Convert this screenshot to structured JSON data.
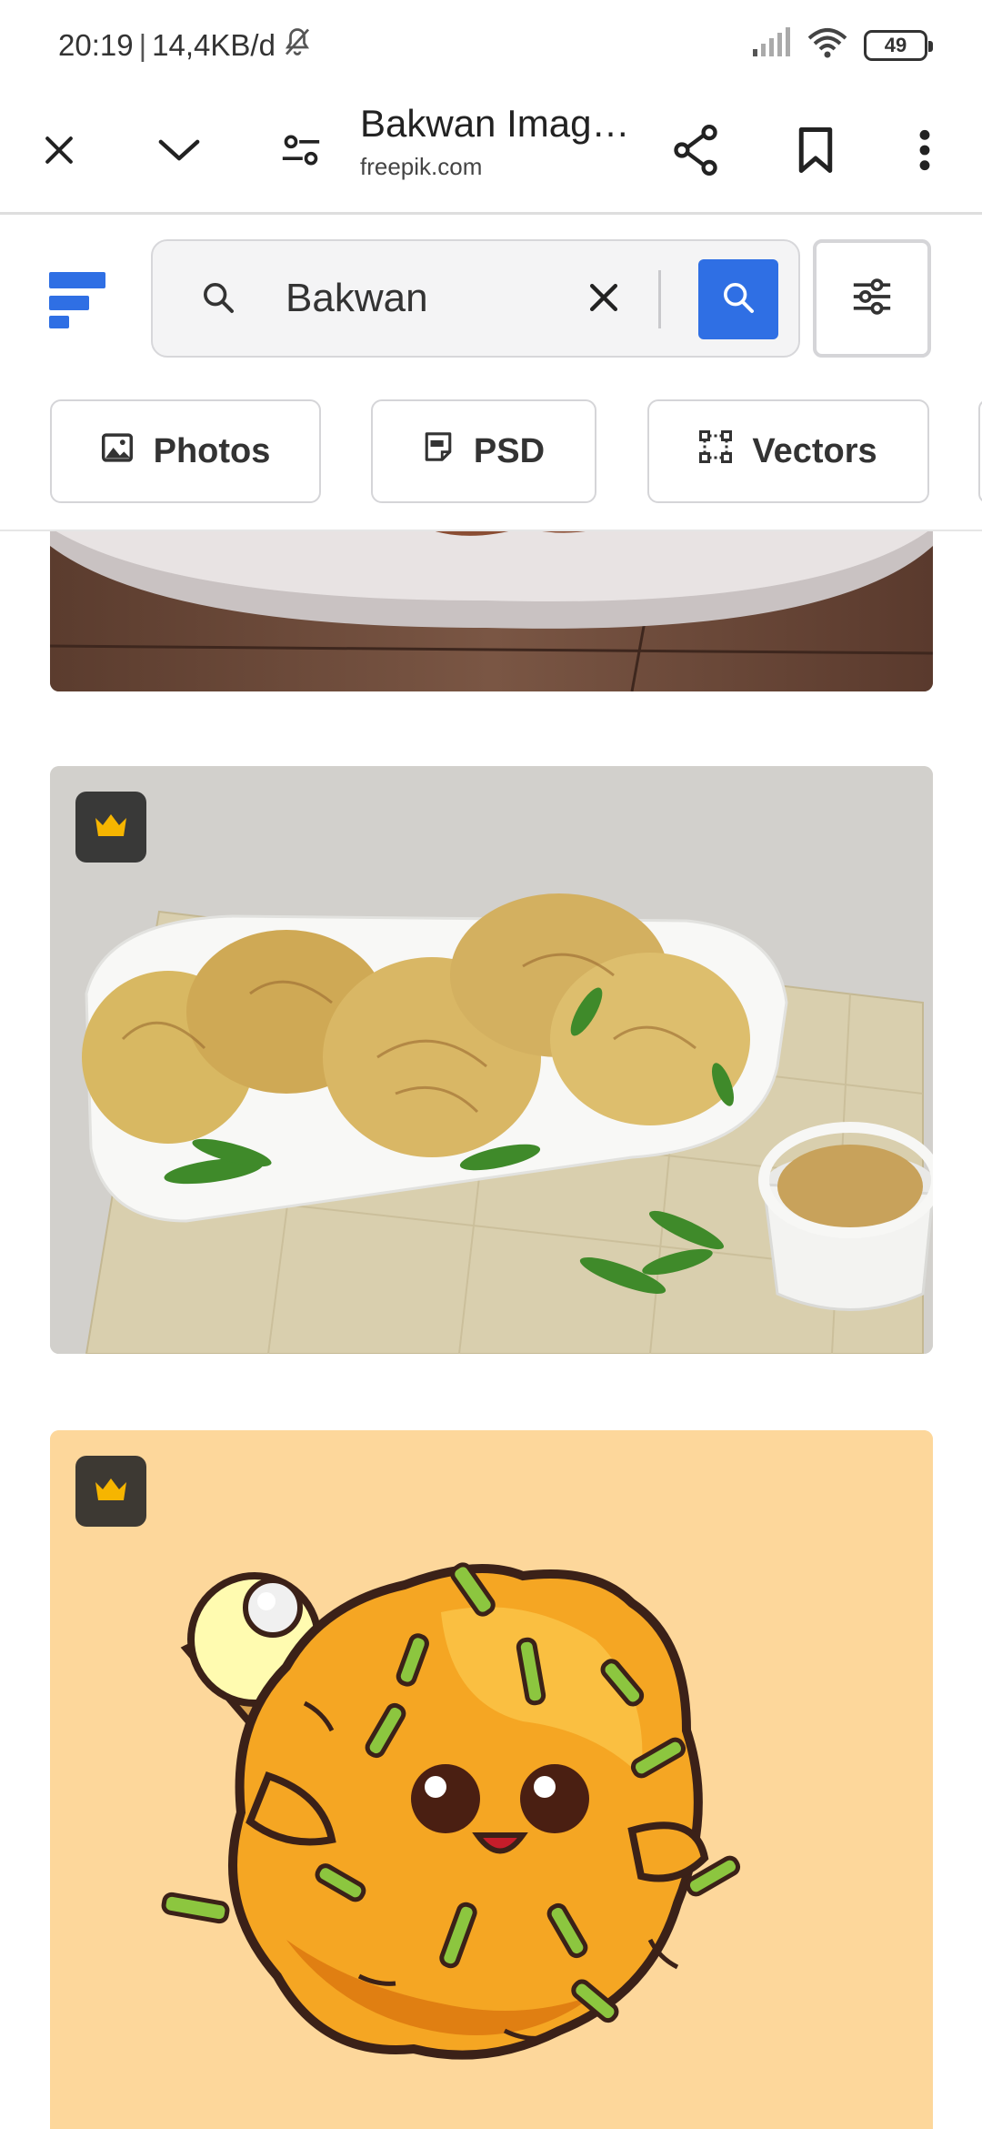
{
  "status": {
    "time": "20:19",
    "separator": "|",
    "network_speed": "14,4KB/d",
    "battery": "49"
  },
  "browser": {
    "page_title": "Bakwan Imag…",
    "domain": "freepik.com"
  },
  "search": {
    "query": "Bakwan"
  },
  "chips": [
    {
      "label": "Photos"
    },
    {
      "label": "PSD"
    },
    {
      "label": "Vectors"
    }
  ],
  "colors": {
    "accent": "#2f6fe4",
    "premium_crown": "#f6b500",
    "card3_background": "#fdd79b"
  },
  "icons": {
    "close": "close-icon",
    "collapse": "chevron-down-icon",
    "site_settings": "tune-icon",
    "share": "share-icon",
    "bookmark": "bookmark-icon",
    "more": "more-vert-icon",
    "search": "search-icon",
    "clear": "clear-icon",
    "filters": "sliders-icon",
    "premium": "crown-icon"
  }
}
